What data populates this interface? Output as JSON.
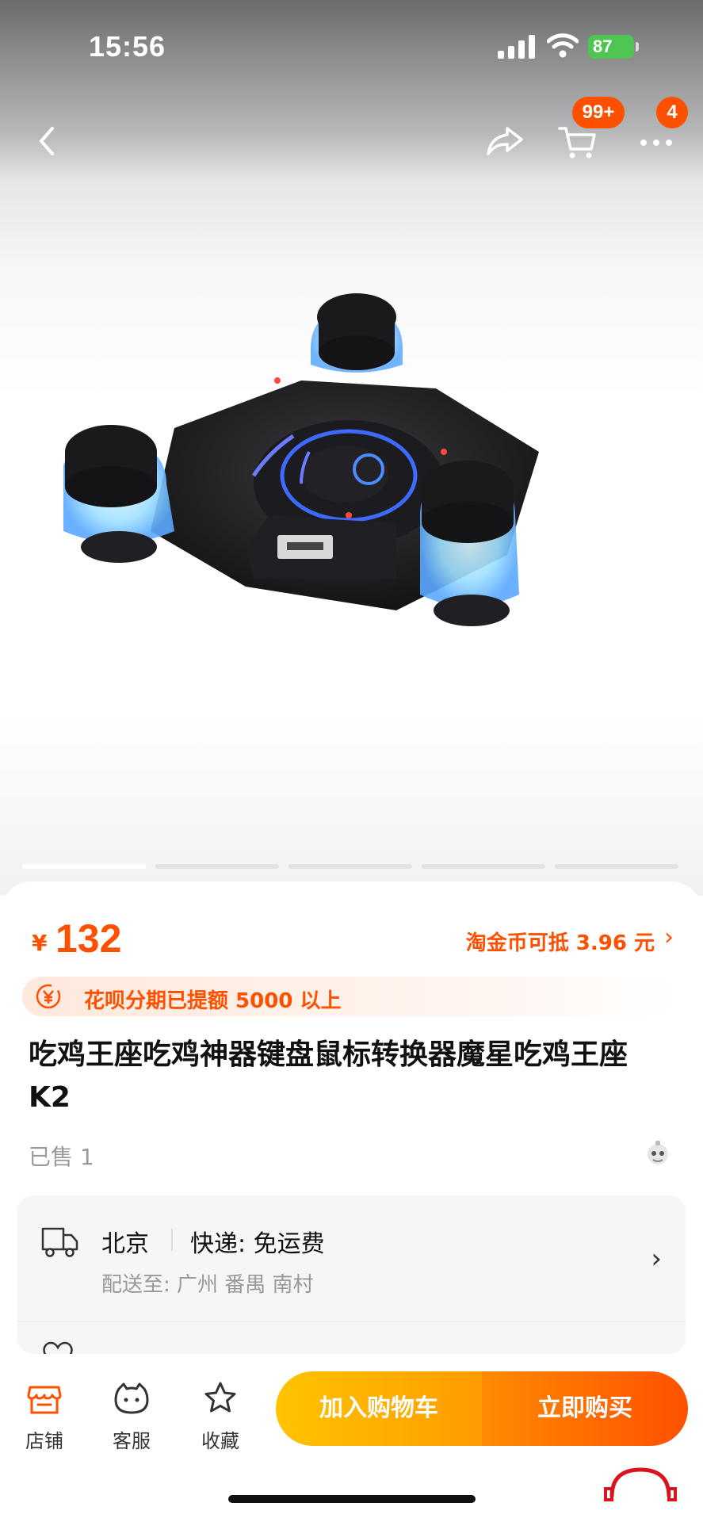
{
  "status_bar": {
    "time": "15:56",
    "battery": "87"
  },
  "nav": {
    "cart_badge": "99+",
    "more_badge": "4"
  },
  "carousel": {
    "total_pages": 5,
    "active_page": 1
  },
  "product": {
    "currency_symbol": "¥",
    "price": "132",
    "coin_deduction": "淘金币可抵 3.96 元",
    "huabei_text": "花呗分期已提额 5000 以上",
    "title": "吃鸡王座吃鸡神器键盘鼠标转换器魔星吃鸡王座 K2",
    "sold": "已售 1"
  },
  "shipping": {
    "origin": "北京",
    "method": "快递: 免运费",
    "deliver_to": "配送至: 广州 番禺 南村"
  },
  "bottom_bar": {
    "store_label": "店铺",
    "service_label": "客服",
    "favorite_label": "收藏",
    "add_to_cart_label": "加入购物车",
    "buy_now_label": "立即购买"
  },
  "colors": {
    "accent": "#ff5000",
    "cart_button": "#ffb300",
    "buy_button": "#ff6a00"
  }
}
